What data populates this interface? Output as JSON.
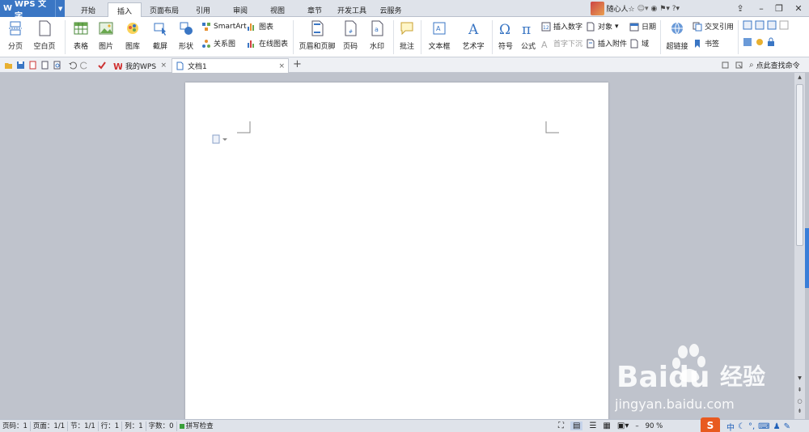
{
  "app": {
    "name": "WPS 文字"
  },
  "ribbon_tabs": [
    "开始",
    "插入",
    "页面布局",
    "引用",
    "审阅",
    "视图",
    "章节",
    "开发工具",
    "云服务"
  ],
  "active_tab": "插入",
  "user": {
    "name": "随心人☆"
  },
  "ribbon": {
    "page_break": "分页",
    "blank_page": "空白页",
    "table": "表格",
    "picture": "图片",
    "gallery": "图库",
    "screenshot": "截屏",
    "shape": "形状",
    "smartart": "SmartArt",
    "chart": "图表",
    "relation": "关系图",
    "online_chart": "在线图表",
    "header_footer": "页眉和页脚",
    "page_number": "页码",
    "watermark": "水印",
    "comment": "批注",
    "textbox": "文本框",
    "wordart": "艺术字",
    "symbol": "符号",
    "formula": "公式",
    "insert_number": "插入数字",
    "drop_cap": "首字下沉",
    "object": "对象",
    "insert_attachment": "插入附件",
    "date": "日期",
    "field": "域",
    "hyperlink": "超链接",
    "cross_reference": "交叉引用",
    "bookmark": "书签"
  },
  "doc_tabs": [
    {
      "label": "我的WPS"
    },
    {
      "label": "文档1"
    }
  ],
  "search": {
    "placeholder": "点此查找命令"
  },
  "status": {
    "page": "页码：1",
    "pages": "页面：1/1",
    "section": "节：1/1",
    "row": "行：1",
    "col": "列：1",
    "words": "字数：0",
    "spell": "拼写检查",
    "zoom": "90 %"
  },
  "ime": {
    "lang": "中"
  },
  "watermark_text": {
    "brand": "Baidu",
    "cn": "经验",
    "url": "jingyan.baidu.com"
  },
  "colors": {
    "accent": "#3a76c4",
    "active_side": "#3a7ed8"
  }
}
